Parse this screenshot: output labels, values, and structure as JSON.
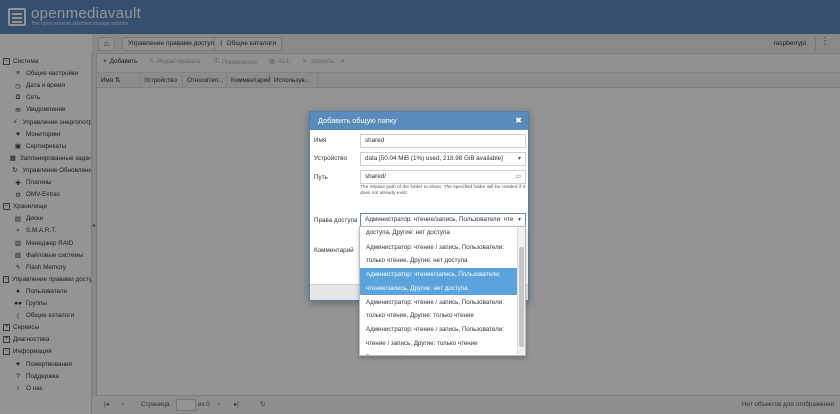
{
  "app": {
    "name": "openmediavault",
    "tagline": "The open network attached storage solution"
  },
  "navbar": {
    "home_icon": "home-icon",
    "crumbs": [
      "Управление правами доступа",
      "Общие каталоги"
    ],
    "user": "raspberrypi"
  },
  "sidebar": {
    "items": [
      {
        "label": "Система",
        "kind": "group"
      },
      {
        "label": "Общие настройки",
        "icon": "sliders-icon"
      },
      {
        "label": "Дата и время",
        "icon": "clock-icon"
      },
      {
        "label": "Сеть",
        "icon": "network-icon"
      },
      {
        "label": "Уведомление",
        "icon": "envelope-icon"
      },
      {
        "label": "Управление энергопотр",
        "icon": "power-icon"
      },
      {
        "label": "Мониторинг",
        "icon": "heartbeat-icon"
      },
      {
        "label": "Сертификаты",
        "icon": "certificate-icon"
      },
      {
        "label": "Запланированные задач",
        "icon": "calendar-icon"
      },
      {
        "label": "Управление Обновлени",
        "icon": "refresh-icon"
      },
      {
        "label": "Плагины",
        "icon": "plugin-icon"
      },
      {
        "label": "OMV-Extras",
        "icon": "cog-icon"
      },
      {
        "label": "Хранилище",
        "kind": "group"
      },
      {
        "label": "Диски",
        "icon": "disk-icon"
      },
      {
        "label": "S.M.A.R.T.",
        "icon": "search-icon"
      },
      {
        "label": "Менеджер RAID",
        "icon": "raid-icon"
      },
      {
        "label": "Файловые системы",
        "icon": "filesystem-icon"
      },
      {
        "label": "Flash Memory",
        "icon": "flash-icon"
      },
      {
        "label": "Управление правами досту",
        "kind": "group"
      },
      {
        "label": "Пользователи",
        "icon": "user-icon"
      },
      {
        "label": "Группы",
        "icon": "users-icon"
      },
      {
        "label": "Общие каталоги",
        "icon": "share-icon"
      },
      {
        "label": "Сервисы",
        "kind": "group-collapsed"
      },
      {
        "label": "Диагностика",
        "kind": "group-collapsed"
      },
      {
        "label": "Информация",
        "kind": "group"
      },
      {
        "label": "Пожертвования",
        "icon": "heart-icon"
      },
      {
        "label": "Поддержка",
        "icon": "question-icon"
      },
      {
        "label": "О нас",
        "icon": "info-icon"
      }
    ]
  },
  "actions": {
    "add": "Добавить",
    "edit": "Редактировать",
    "privileges": "Привилегии",
    "acl": "ACL",
    "delete": "Удалить"
  },
  "grid": {
    "columns": [
      "Имя",
      "Устройство",
      "Относител...",
      "Комментарий",
      "Использув..."
    ]
  },
  "pager": {
    "page_label": "Страница",
    "page_of": "из 0",
    "status": "Нет объектов для отображения"
  },
  "dialog": {
    "title": "Добавить общую папку",
    "name_label": "Имя",
    "name_value": "shared",
    "device_label": "Устройство",
    "device_value": "data [50.04 MiB (1%) used, 218.98 GiB available]",
    "path_label": "Путь",
    "path_value": "shared/",
    "path_hint": "The relative path of the folder to share. The specified folder will be created if it does not already exist.",
    "perm_label": "Права доступа",
    "perm_value": "Администратор: чтение/запись, Пользователи: чте",
    "comment_label": "Комментарий"
  },
  "dropdown": {
    "options": [
      [
        "доступа, Другие: нет доступа"
      ],
      [
        "Администратор: чтение / запись, Пользователи:",
        "только чтение, Другие: нет доступа"
      ],
      [
        "Администратор: чтение/запись, Пользователи:",
        "чтение/запись, Другие: нет доступа"
      ],
      [
        "Администратор: чтение / запись, Пользователи:",
        "только чтение, Другие: только чтение"
      ],
      [
        "Администратор: чтение / запись, Пользователи:",
        "чтение / запись, Другие: только чтение"
      ],
      [
        "Все: чтение/запись"
      ]
    ],
    "selected_index": 2
  }
}
